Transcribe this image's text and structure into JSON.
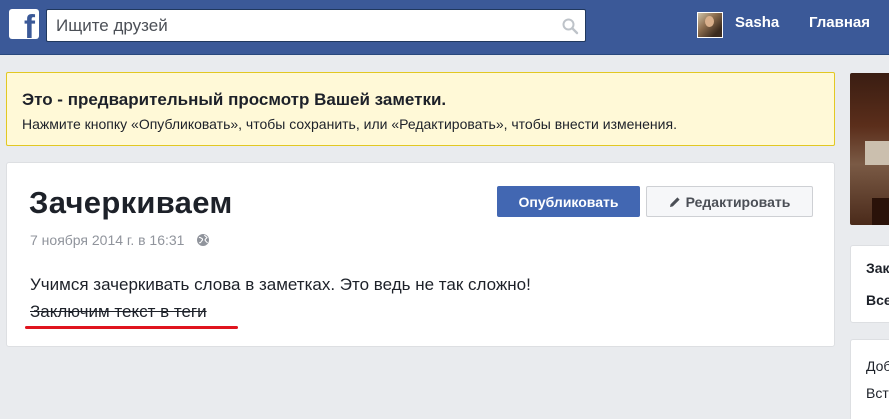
{
  "header": {
    "logo_letter": "f",
    "search_placeholder": "Ищите друзей",
    "user_name": "Sasha",
    "home_link": "Главная",
    "brand_color": "#3b5998"
  },
  "notice": {
    "title": "Это - предварительный просмотр Вашей заметки.",
    "body": "Нажмите кнопку «Опубликовать», чтобы сохранить, или «Редактировать», чтобы внести изменения."
  },
  "note": {
    "title": "Зачеркиваем",
    "date": "7 ноября 2014 г. в 16:31",
    "privacy_icon": "globe-icon",
    "publish_label": "Опубликовать",
    "edit_label": "Редактировать",
    "edit_icon": "pencil-icon",
    "line1": "Учимся зачеркивать слова в заметках. Это ведь не так сложно!",
    "line2_struck": "Заключим текст в теги",
    "underline_color": "#e0141e"
  },
  "sidebar": {
    "box1_line1": "Зак",
    "box1_line2": "Все",
    "box2_line1": "Доб",
    "box2_line2": "Вст"
  }
}
